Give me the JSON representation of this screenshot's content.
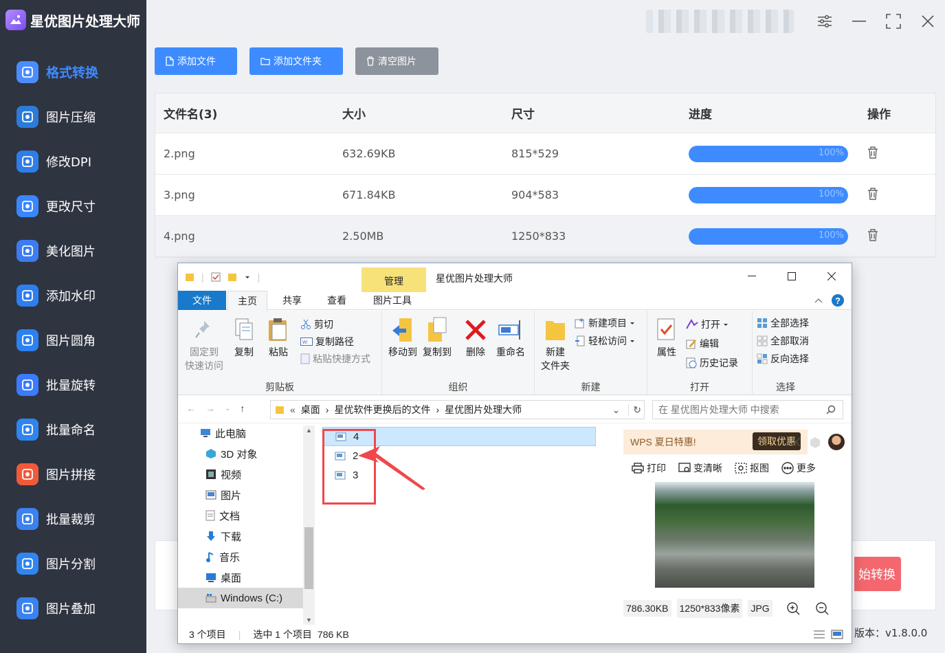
{
  "app": {
    "title": "星优图片处理大师",
    "version_label": "版本：v1.8.0.0",
    "start_label": "始转换"
  },
  "sidebar": {
    "items": [
      {
        "label": "格式转换",
        "icon": "image-convert-icon",
        "active": true
      },
      {
        "label": "图片压缩",
        "icon": "compress-icon"
      },
      {
        "label": "修改DPI",
        "icon": "dpi-icon"
      },
      {
        "label": "更改尺寸",
        "icon": "resize-icon"
      },
      {
        "label": "美化图片",
        "icon": "beautify-icon"
      },
      {
        "label": "添加水印",
        "icon": "watermark-icon"
      },
      {
        "label": "图片圆角",
        "icon": "rounded-corner-icon"
      },
      {
        "label": "批量旋转",
        "icon": "rotate-icon"
      },
      {
        "label": "批量命名",
        "icon": "rename-icon"
      },
      {
        "label": "图片拼接",
        "icon": "puzzle-icon"
      },
      {
        "label": "批量裁剪",
        "icon": "crop-icon"
      },
      {
        "label": "图片分割",
        "icon": "split-icon"
      },
      {
        "label": "图片叠加",
        "icon": "layers-icon"
      }
    ]
  },
  "toolbar": {
    "add_file": "添加文件",
    "add_folder": "添加文件夹",
    "clear": "清空图片"
  },
  "table": {
    "headers": [
      "文件名(3)",
      "大小",
      "尺寸",
      "进度",
      "操作"
    ],
    "rows": [
      {
        "name": "2.png",
        "size": "632.69KB",
        "dims": "815*529",
        "progress": 1.0,
        "progress_label": "100%"
      },
      {
        "name": "3.png",
        "size": "671.84KB",
        "dims": "904*583",
        "progress": 1.0,
        "progress_label": "100%"
      },
      {
        "name": "4.png",
        "size": "2.50MB",
        "dims": "1250*833",
        "progress": 1.0,
        "progress_label": "100%"
      }
    ]
  },
  "explorer": {
    "title": "星优图片处理大师",
    "context_tab": "管理",
    "tabs": {
      "file": "文件",
      "home": "主页",
      "share": "共享",
      "view": "查看",
      "tools": "图片工具"
    },
    "ribbon": {
      "pin": "固定到",
      "pin2": "快速访问",
      "copy": "复制",
      "paste": "粘贴",
      "cut": "剪切",
      "copy_path": "复制路径",
      "paste_shortcut": "粘贴快捷方式",
      "clipboard": "剪贴板",
      "move_to": "移动到",
      "copy_to": "复制到",
      "delete": "删除",
      "rename": "重命名",
      "organize": "组织",
      "new_folder": "新建",
      "new_folder2": "文件夹",
      "new_item": "新建项目",
      "easy_access": "轻松访问",
      "new": "新建",
      "properties": "属性",
      "open": "打开",
      "edit": "编辑",
      "history": "历史记录",
      "open_group": "打开",
      "select_all": "全部选择",
      "select_none": "全部取消",
      "invert": "反向选择",
      "select": "选择"
    },
    "breadcrumb": [
      "桌面",
      "星优软件更换后的文件",
      "星优图片处理大师"
    ],
    "search_placeholder": "在 星优图片处理大师 中搜索",
    "tree": [
      {
        "label": "此电脑",
        "icon": "computer-icon"
      },
      {
        "label": "3D 对象",
        "icon": "cube-icon"
      },
      {
        "label": "视频",
        "icon": "video-icon"
      },
      {
        "label": "图片",
        "icon": "pictures-icon"
      },
      {
        "label": "文档",
        "icon": "document-icon"
      },
      {
        "label": "下载",
        "icon": "download-icon"
      },
      {
        "label": "音乐",
        "icon": "music-icon"
      },
      {
        "label": "桌面",
        "icon": "desktop-icon"
      },
      {
        "label": "Windows (C:)",
        "icon": "drive-icon",
        "selected": true
      }
    ],
    "files": [
      {
        "name": "4",
        "selected": true
      },
      {
        "name": "2"
      },
      {
        "name": "3"
      }
    ],
    "preview": {
      "wps_text": "WPS 夏日特惠!",
      "wps_button": "领取优惠",
      "tools": [
        "打印",
        "变清晰",
        "抠图",
        "更多"
      ],
      "size": "786.30KB",
      "dims": "1250*833像素",
      "format": "JPG"
    },
    "status": {
      "count": "3 个项目",
      "selected": "选中 1 个项目",
      "selected_size": "786 KB"
    }
  }
}
